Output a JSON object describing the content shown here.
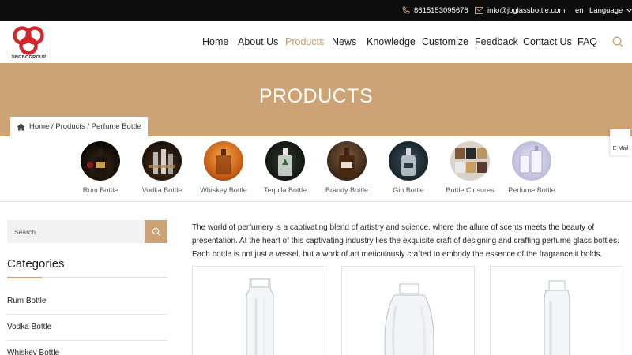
{
  "topbar": {
    "phone": "8615153095676",
    "email": "info@jbglassbottle.com",
    "lang_code": "en",
    "lang_label": "Language"
  },
  "brand": {
    "logo_text": "JINGBOGROUP",
    "logo_color": "#d6252b"
  },
  "nav": {
    "items": [
      "Home",
      "About Us",
      "Products",
      "News",
      "Knowledge",
      "Customize",
      "Feedback",
      "Contact Us",
      "FAQ"
    ],
    "active": "Products"
  },
  "banner": {
    "title": "PRODUCTS",
    "bg_color": "#cda274"
  },
  "breadcrumb": {
    "text": "Home / Products / Perfume Bottle"
  },
  "email_tab": "E-Mail",
  "categories_strip": [
    {
      "label": "Rum Bottle",
      "icon": "rum-bottle-photo"
    },
    {
      "label": "Vodka Bottle",
      "icon": "vodka-bottle-photo"
    },
    {
      "label": "Whiskey Bottle",
      "icon": "whiskey-bottle-photo"
    },
    {
      "label": "Tequila Bottle",
      "icon": "tequila-bottle-photo"
    },
    {
      "label": "Brandy Bottle",
      "icon": "brandy-bottle-photo"
    },
    {
      "label": "Gin Bottle",
      "icon": "gin-bottle-photo"
    },
    {
      "label": "Bottle Closures",
      "icon": "bottle-closures-photo"
    },
    {
      "label": "Perfume Bottle",
      "icon": "perfume-bottle-photo"
    }
  ],
  "sidebar": {
    "search_placeholder": "Search...",
    "title": "Categories",
    "items": [
      "Rum Bottle",
      "Vodka Bottle",
      "Whiskey Bottle"
    ]
  },
  "main": {
    "intro": "The world of perfumery is a captivating blend of artistry and science, where the allure of scents meets the beauty of presentation. At the heart of this captivating industry lies the exquisite craft of designing and crafting perfume glass bottles. Each bottle is not just a vessel, but a work of art meticulously crafted to embody the essence of the fragrance it holds."
  }
}
